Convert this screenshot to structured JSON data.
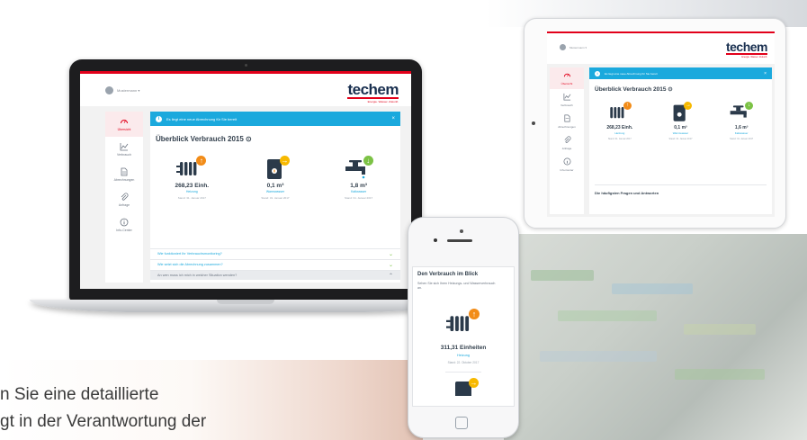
{
  "colors": {
    "brand_red": "#e2001a",
    "accent_blue": "#1ba9dd",
    "heating_orange": "#f28c18",
    "water_yellow": "#f7b900",
    "cold_green": "#7cc245",
    "navy": "#1a3050"
  },
  "background": {
    "text_lines": [
      "n Sie eine detaillierte",
      "gt in der Verantwortung der"
    ]
  },
  "brand": {
    "name": "techem",
    "tagline": "Energie. Wasser. Zukunft."
  },
  "laptop": {
    "user_name": "Mustermann ▾",
    "sidebar": [
      {
        "label": "Übersicht",
        "icon": "gauge-icon",
        "active": true
      },
      {
        "label": "Verbrauch",
        "icon": "chart-icon",
        "active": false
      },
      {
        "label": "Abrechnungen",
        "icon": "document-icon",
        "active": false
      },
      {
        "label": "Anfrage",
        "icon": "paperclip-icon",
        "active": false
      },
      {
        "label": "Info-Center",
        "icon": "info-icon",
        "active": false
      }
    ],
    "banner": "Es liegt eine neue Abrechnung für Sie bereit",
    "title": "Überblick Verbrauch 2015 ⊙",
    "tiles": [
      {
        "value": "268,23 Einh.",
        "label": "Heizung",
        "date": "Stand: 31. Januar 2017",
        "icon": "radiator-icon"
      },
      {
        "value": "0,1 m³",
        "label": "Warmwasser",
        "date": "Stand: 31. Januar 2017",
        "icon": "boiler-icon"
      },
      {
        "value": "1,8 m³",
        "label": "Kaltwasser",
        "date": "Stand: 31. Januar 2017",
        "icon": "faucet-icon"
      }
    ],
    "faq": [
      "Wie funktioniert Ihr Verbrauchsmonitoring?",
      "Wie setzt sich die Abrechnung zusammen?",
      "An wen muss ich mich in welcher Situation wenden?"
    ]
  },
  "tablet": {
    "user_name": "Mustermann ▾",
    "sidebar": [
      {
        "label": "Übersicht",
        "icon": "gauge-icon",
        "active": true
      },
      {
        "label": "Verbrauch",
        "icon": "chart-icon",
        "active": false
      },
      {
        "label": "Abrechnungen",
        "icon": "document-icon",
        "active": false
      },
      {
        "label": "Anfrage",
        "icon": "paperclip-icon",
        "active": false
      },
      {
        "label": "Info-Center",
        "icon": "info-icon",
        "active": false
      }
    ],
    "banner": "Es liegt eine neue Abrechnung für Sie bereit",
    "title": "Überblick Verbrauch 2015 ⊙",
    "tiles": [
      {
        "value": "268,23 Einh.",
        "label": "Heizung",
        "date": "Stand: 31. Januar 2017"
      },
      {
        "value": "0,1 m³",
        "label": "Warmwasser",
        "date": "Stand: 31. Januar 2017"
      },
      {
        "value": "1,6 m³",
        "label": "Kaltwasser",
        "date": "Stand: 31. Januar 2017"
      }
    ],
    "faq_heading": "Die häufigsten Fragen und Antworten"
  },
  "phone": {
    "title": "Den Verbrauch im Blick",
    "subtitle": "Sehen Sie sich Ihren Heizungs- und Wasserverbrauch an.",
    "value": "311,31 Einheiten",
    "label": "Heizung",
    "date": "Stand: 22. Oktober 2017"
  }
}
